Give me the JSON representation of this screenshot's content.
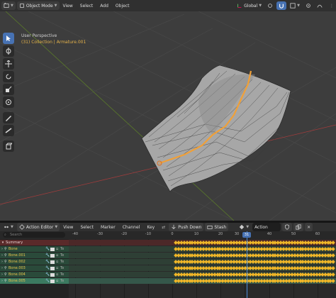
{
  "viewport_header": {
    "mode": "Object Mode",
    "menus": [
      "View",
      "Select",
      "Add",
      "Object"
    ],
    "orientation": "Global"
  },
  "viewport": {
    "perspective": "User Perspective",
    "collection": "(31) Collection | Armature.001",
    "tools": [
      "cursor",
      "move",
      "rotate",
      "scale",
      "transform",
      "annotate",
      "measure",
      "add-cube"
    ]
  },
  "action_editor": {
    "editor_type": "Action Editor",
    "menus": [
      "View",
      "Select",
      "Marker",
      "Channel",
      "Key"
    ],
    "push_down": "Push Down",
    "stash": "Stash",
    "action": "Action",
    "current_frame": "31",
    "ruler_ticks": [
      "-40",
      "-30",
      "-20",
      "-10",
      "0",
      "10",
      "20",
      "30",
      "40",
      "50",
      "60"
    ],
    "search_placeholder": "Search",
    "summary_label": "Summary",
    "bones": [
      {
        "name": "Bone",
        "selected": false
      },
      {
        "name": "Bone.001",
        "selected": false
      },
      {
        "name": "Bone.002",
        "selected": false
      },
      {
        "name": "Bone.003",
        "selected": false
      },
      {
        "name": "Bone.004",
        "selected": false
      },
      {
        "name": "Bone.005",
        "selected": true
      }
    ],
    "bone_row_suffix": "Te"
  },
  "colors": {
    "keyframe": "#f0b628",
    "accent": "#4772b3",
    "selected_orange": "#e6b34b"
  }
}
